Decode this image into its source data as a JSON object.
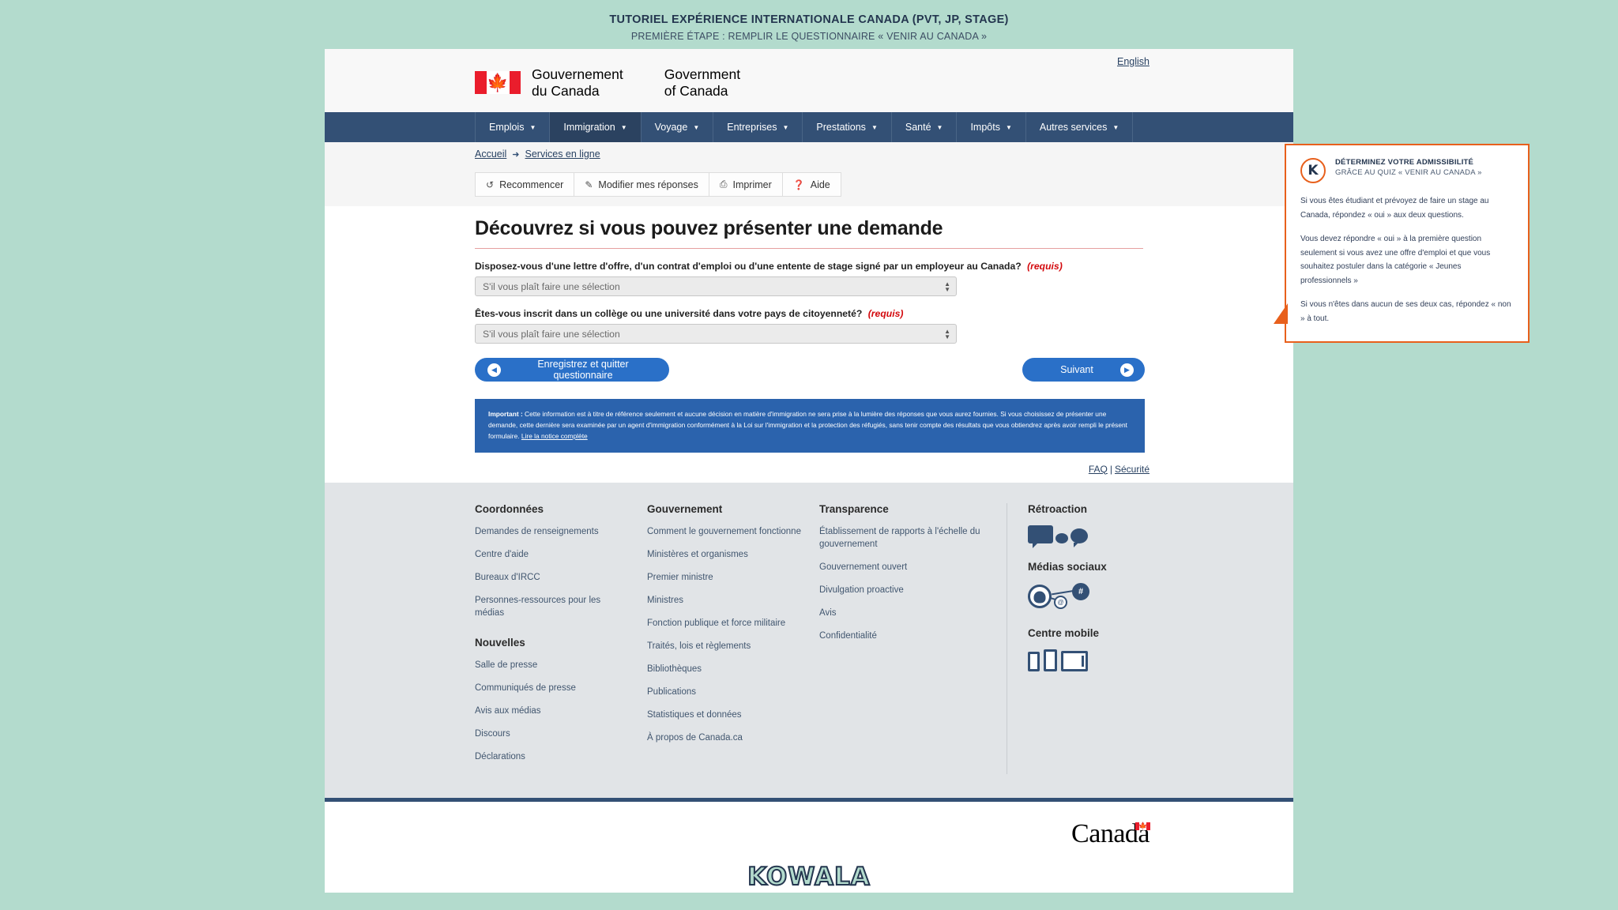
{
  "slide": {
    "title": "TUTORIEL EXPÉRIENCE INTERNATIONALE CANADA (PVT, JP, STAGE)",
    "subtitle": "PREMIÈRE ÉTAPE : REMPLIR LE QUESTIONNAIRE « VENIR AU CANADA »",
    "brand_logo": "KOWALA"
  },
  "header": {
    "language_link": "English",
    "brand_fr": "Gouvernement\ndu Canada",
    "brand_fr_line1": "Gouvernement",
    "brand_fr_line2": "du Canada",
    "brand_en_line1": "Government",
    "brand_en_line2": "of Canada",
    "flag_icon": "canada-flag-icon"
  },
  "nav": {
    "items": [
      {
        "label": "Emplois",
        "active": false
      },
      {
        "label": "Immigration",
        "active": true
      },
      {
        "label": "Voyage",
        "active": false
      },
      {
        "label": "Entreprises",
        "active": false
      },
      {
        "label": "Prestations",
        "active": false
      },
      {
        "label": "Santé",
        "active": false
      },
      {
        "label": "Impôts",
        "active": false
      },
      {
        "label": "Autres services",
        "active": false
      }
    ],
    "caret_icon": "chevron-down-icon"
  },
  "breadcrumb": {
    "items": [
      "Accueil",
      "Services en ligne"
    ],
    "separator": "➜"
  },
  "toolbar": {
    "buttons": [
      {
        "label": "Recommencer",
        "icon": "refresh-icon",
        "glyph": "↺"
      },
      {
        "label": "Modifier mes réponses",
        "icon": "pencil-icon",
        "glyph": "✎"
      },
      {
        "label": "Imprimer",
        "icon": "printer-icon",
        "glyph": "⎙"
      },
      {
        "label": "Aide",
        "icon": "help-circle-icon",
        "glyph": "?"
      }
    ]
  },
  "main": {
    "title": "Découvrez si vous pouvez présenter une demande",
    "required_tag": "(requis)",
    "questions": [
      {
        "label": "Disposez-vous d'une lettre d'offre, d'un contrat d'emploi ou d'une entente de stage signé par un employeur au Canada?",
        "value": "S'il vous plaît faire une sélection"
      },
      {
        "label": "Êtes-vous inscrit dans un collège ou une université dans votre pays de citoyenneté?",
        "value": "S'il vous plaît faire une sélection"
      }
    ],
    "back_button": "Enregistrez et quitter questionnaire",
    "next_button": "Suivant",
    "notice": {
      "strong": "Important :",
      "text": " Cette information est à titre de référence seulement et aucune décision en matière d'immigration ne sera prise à la lumière des réponses que vous aurez fournies. Si vous choisissez de présenter une demande, cette dernière sera examinée par un agent d'immigration conformément à la Loi sur l'immigration et la protection des réfugiés, sans tenir compte des résultats que vous obtiendrez après avoir rempli le présent formulaire. ",
      "link": "Lire la notice complète"
    }
  },
  "subfooter": {
    "faq": "FAQ",
    "separator": "|",
    "security": "Sécurité"
  },
  "footer": {
    "columns": [
      {
        "heading": "Coordonnées",
        "links": [
          "Demandes de renseignements",
          "Centre d'aide",
          "Bureaux d'IRCC",
          "Personnes-ressources pour les médias"
        ],
        "heading2": "Nouvelles",
        "links2": [
          "Salle de presse",
          "Communiqués de presse",
          "Avis aux médias",
          "Discours",
          "Déclarations"
        ]
      },
      {
        "heading": "Gouvernement",
        "links": [
          "Comment le gouvernement fonctionne",
          "Ministères et organismes",
          "Premier ministre",
          "Ministres",
          "Fonction publique et force militaire",
          "Traités, lois et règlements",
          "Bibliothèques",
          "Publications",
          "Statistiques et données",
          "À propos de Canada.ca"
        ]
      },
      {
        "heading": "Transparence",
        "links": [
          "Établissement de rapports à l'échelle du gouvernement",
          "Gouvernement ouvert",
          "Divulgation proactive",
          "Avis",
          "Confidentialité"
        ]
      }
    ],
    "right": {
      "feedback_heading": "Rétroaction",
      "feedback_icon": "speech-bubbles-icon",
      "social_heading": "Médias sociaux",
      "social_icon": "social-network-icon",
      "mobile_heading": "Centre mobile",
      "mobile_icon": "mobile-devices-icon"
    },
    "wordmark": "Canada",
    "wordmark_flag_icon": "canada-flag-icon"
  },
  "callout": {
    "badge": "K",
    "title_line1": "DÉTERMINEZ VOTRE ADMISSIBILITÉ",
    "title_line2": "GRÂCE AU QUIZ « VENIR AU CANADA »",
    "paragraphs": [
      "Si vous êtes étudiant et prévoyez de faire un stage au Canada, répondez « oui » aux deux questions.",
      "Vous devez répondre « oui » à la première question seulement si vous avez une offre d'emploi et que vous souhaitez postuler dans la catégorie « Jeunes professionnels »",
      "Si vous n'êtes dans aucun de ses deux cas, répondez « non » à tout."
    ]
  },
  "colors": {
    "slide_background": "#b3dbcd",
    "nav_blue": "#335075",
    "accent_orange": "#e8601c",
    "button_blue": "#2a70c8",
    "notice_blue": "#2b63ad",
    "required_red": "#d3080c",
    "flag_red": "#ea1d2c"
  }
}
